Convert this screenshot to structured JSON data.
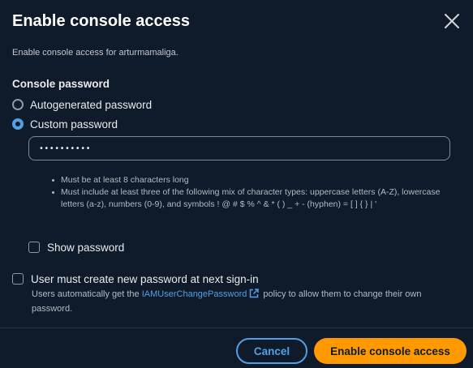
{
  "dialog": {
    "title": "Enable console access",
    "subtitle": "Enable console access for arturmamaliga.",
    "close_icon": "close-icon"
  },
  "password_section": {
    "label": "Console password",
    "options": [
      {
        "label": "Autogenerated password",
        "selected": false
      },
      {
        "label": "Custom password",
        "selected": true
      }
    ],
    "input_value": "••••••••••",
    "rules": [
      "Must be at least 8 characters long",
      "Must include at least three of the following mix of character types: uppercase letters (A-Z), lowercase letters (a-z), numbers (0-9), and symbols ! @ # $ % ^ & * ( ) _ + - (hyphen) = [ ] { } | '"
    ],
    "show_password_label": "Show password",
    "show_password_checked": false
  },
  "reset": {
    "label": "User must create new password at next sign-in",
    "checked": false,
    "helper_before": "Users automatically get the ",
    "helper_link": "IAMUserChangePassword",
    "helper_after": " policy to allow them to change their own password.",
    "link_icon": "external-link-icon"
  },
  "footer": {
    "cancel_label": "Cancel",
    "submit_label": "Enable console access"
  },
  "colors": {
    "background": "#0f1b2a",
    "accent": "#539fe5",
    "primary_button": "#ff9900"
  }
}
